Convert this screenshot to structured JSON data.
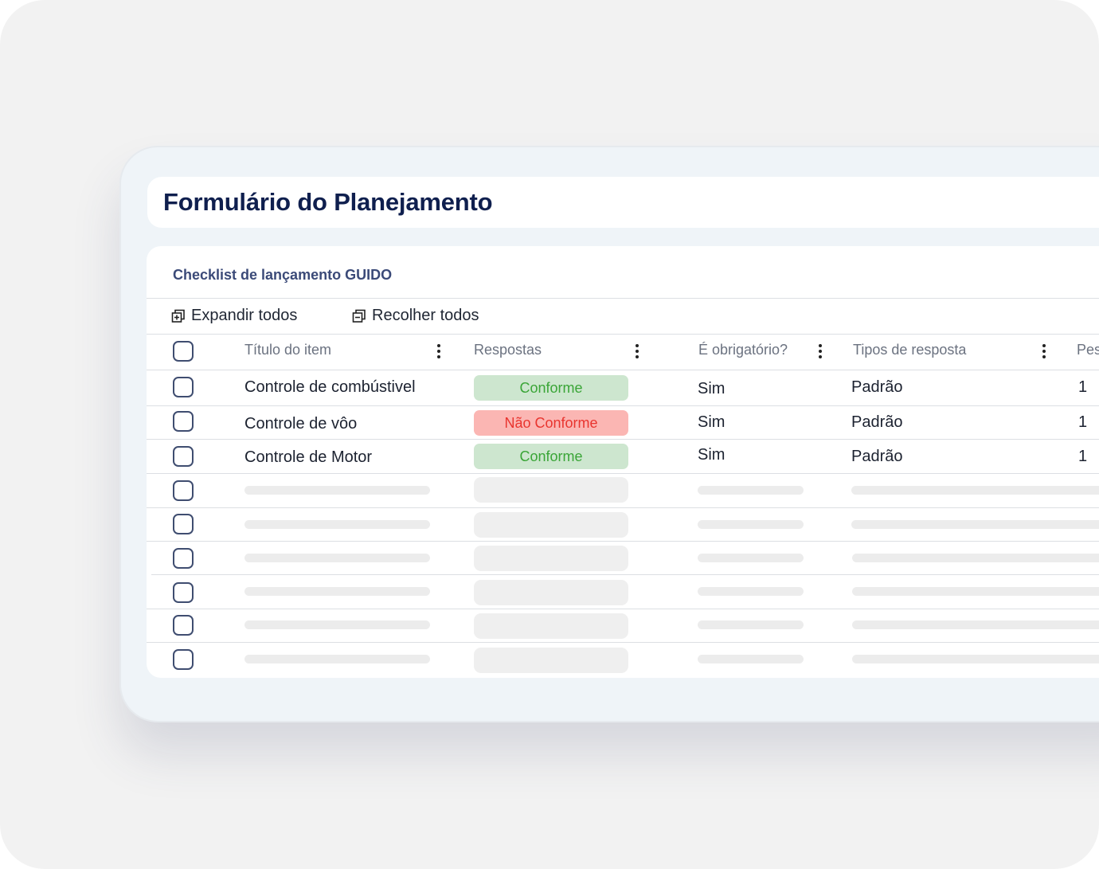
{
  "page_title": "Formulário do Planejamento",
  "checklist": {
    "title": "Checklist de lançamento GUIDO",
    "expand_all": "Expandir todos",
    "collapse_all": "Recolher todos"
  },
  "table": {
    "columns": [
      "Título do item",
      "Respostas",
      "É obrigatório?",
      "Tipos de resposta",
      "Pes"
    ],
    "rows": [
      {
        "titulo": "Controle de combústivel",
        "resposta": "Conforme",
        "status": "conforme",
        "obrigatorio": "Sim",
        "tipo": "Padrão",
        "peso": "1"
      },
      {
        "titulo": "Controle de vôo",
        "resposta": "Não Conforme",
        "status": "nao-conforme",
        "obrigatorio": "Sim",
        "tipo": "Padrão",
        "peso": "1"
      },
      {
        "titulo": "Controle de Motor",
        "resposta": "Conforme",
        "status": "conforme",
        "obrigatorio": "Sim",
        "tipo": "Padrão",
        "peso": "1"
      }
    ],
    "placeholder_rows": 6
  },
  "colors": {
    "title": "#0f1f4e",
    "conforme_bg": "#cde6cf",
    "conforme_text": "#3aa537",
    "nao_conforme_bg": "#fbb6b3",
    "nao_conforme_text": "#e9352f"
  }
}
